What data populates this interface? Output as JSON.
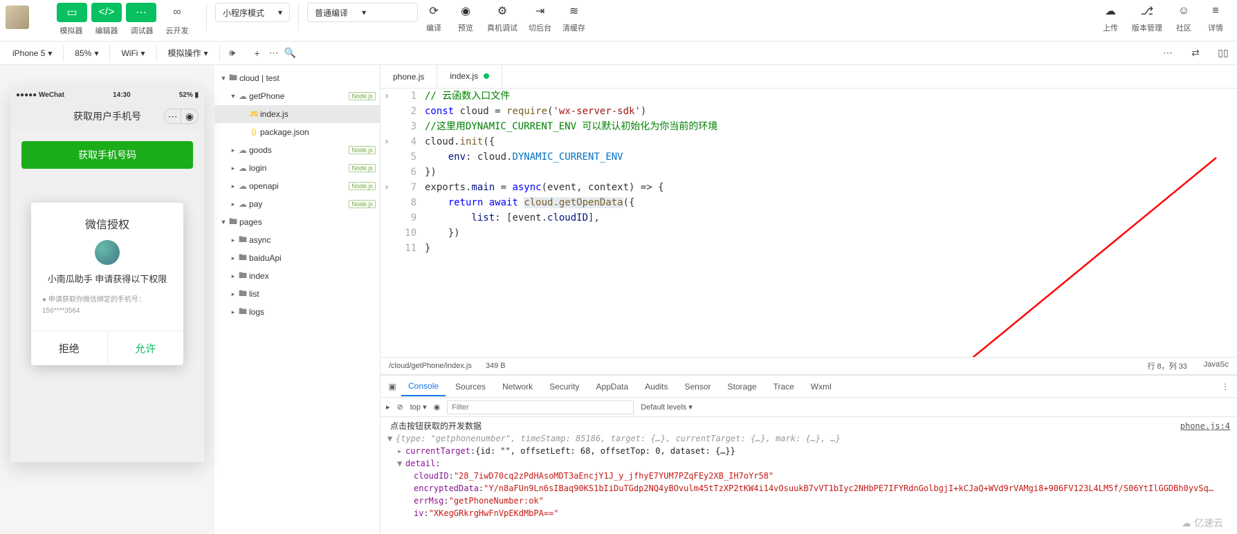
{
  "toolbar": {
    "sim_label": "模拟器",
    "editor_label": "编辑器",
    "debugger_label": "调试器",
    "cloud_label": "云开发",
    "mode_select": "小程序模式",
    "compile_select": "普通编译",
    "compile_label": "编译",
    "preview_label": "预览",
    "real_debug_label": "真机调试",
    "bg_label": "切后台",
    "clear_cache_label": "清缓存",
    "upload_label": "上传",
    "version_label": "版本管理",
    "community_label": "社区",
    "details_label": "详情"
  },
  "secbar": {
    "device": "iPhone 5",
    "zoom": "85%",
    "network": "WiFi",
    "sim_ops": "模拟操作"
  },
  "phone": {
    "carrier": "●●●●● WeChat",
    "time": "14:30",
    "battery": "52%",
    "nav_title": "获取用户手机号",
    "button_text": "获取手机号码",
    "modal_title": "微信授权",
    "modal_sub": "小南瓜助手 申请获得以下权限",
    "modal_hint": "● 申请获取你微信绑定的手机号：156****3564",
    "deny": "拒绝",
    "allow": "允许"
  },
  "tree": {
    "root": "cloud | test",
    "getPhone": "getPhone",
    "indexjs": "index.js",
    "packagejson": "package.json",
    "goods": "goods",
    "login": "login",
    "openapi": "openapi",
    "pay": "pay",
    "pages": "pages",
    "async": "async",
    "baiduApi": "baiduApi",
    "index": "index",
    "list": "list",
    "logs": "logs",
    "nodejs_badge": "Node.js"
  },
  "tabs": {
    "phone": "phone.js",
    "index": "index.js"
  },
  "code": {
    "l1": "// 云函数入口文件",
    "l2a": "const",
    "l2b": " cloud = ",
    "l2c": "require",
    "l2d": "(",
    "l2e": "'wx-server-sdk'",
    "l2f": ")",
    "l3": "//这里用DYNAMIC_CURRENT_ENV 可以默认初始化为你当前的环境",
    "l4a": "cloud.",
    "l4b": "init",
    "l4c": "({",
    "l5a": "    env",
    "l5b": ": cloud.",
    "l5c": "DYNAMIC_CURRENT_ENV",
    "l6": "})",
    "l7a": "exports.",
    "l7b": "main",
    "l7c": " = ",
    "l7d": "async",
    "l7e": "(event, context) => {",
    "l8a": "    ",
    "l8b": "return",
    "l8c": " ",
    "l8d": "await",
    "l8e": " ",
    "l8f": "cloud.getOpenData",
    "l8g": "({",
    "l9a": "        list",
    "l9b": ": [event.",
    "l9c": "cloudID",
    "l9d": "],",
    "l10": "    })",
    "l11": "}"
  },
  "status": {
    "path": "/cloud/getPhone/index.js",
    "size": "349 B",
    "cursor": "行 8，列 33",
    "lang": "JavaSc"
  },
  "devtools": {
    "tabs": [
      "Console",
      "Sources",
      "Network",
      "Security",
      "AppData",
      "Audits",
      "Sensor",
      "Storage",
      "Trace",
      "Wxml"
    ],
    "top": "top",
    "filter_placeholder": "Filter",
    "levels": "Default levels",
    "log_title": "点击按钮获取的开发数据",
    "log_src": "phone.js:4",
    "obj_preview": "{type: \"getphonenumber\", timeStamp: 85186, target: {…}, currentTarget: {…}, mark: {…}, …}",
    "ct_key": "currentTarget",
    "ct_val": "{id: \"\", offsetLeft: 68, offsetTop: 0, dataset: {…}}",
    "detail_key": "detail",
    "cloudID_key": "cloudID",
    "cloudID_val": "\"28_7iwD70cq2zPdHAsoMDT3aEncjY1J_y_jfhyE7YUM7PZqFEy2XB_IH7oYr58\"",
    "enc_key": "encryptedData",
    "enc_val": "\"Y/n8aFUn9Ln6sIBaq90KS1bIiDuTGdp2NQ4yBOvulm45tTzXP2tKW4i14vOsuukB7vVT1bIyc2NHbPE7IFYRdnGolbgjI+kCJaQ+WVd9rVAMgi8+906FV123L4LM5f/S06YtIlGGDBh0yvSq…",
    "err_key": "errMsg",
    "err_val": "\"getPhoneNumber:ok\"",
    "iv_key": "iv",
    "iv_val": "\"XKegGRkrgHwFnVpEKdMbPA==\""
  },
  "watermark": "亿速云"
}
